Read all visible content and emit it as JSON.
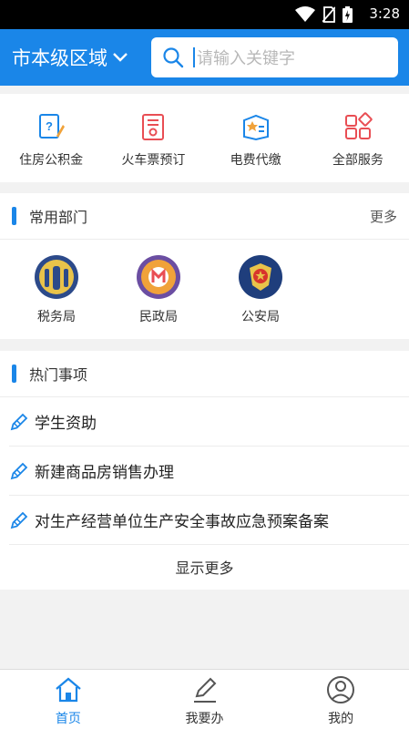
{
  "status_bar": {
    "time": "3:28"
  },
  "header": {
    "region": "市本级区域",
    "search_placeholder": "请输入关键字"
  },
  "services": [
    {
      "label": "住房公积金",
      "icon": "housing-fund-icon"
    },
    {
      "label": "火车票预订",
      "icon": "train-ticket-icon"
    },
    {
      "label": "电费代缴",
      "icon": "electricity-bill-icon"
    },
    {
      "label": "全部服务",
      "icon": "all-services-icon"
    }
  ],
  "departments": {
    "title": "常用部门",
    "more": "更多",
    "items": [
      {
        "label": "税务局",
        "icon": "tax-bureau-emblem-icon"
      },
      {
        "label": "民政局",
        "icon": "civil-affairs-emblem-icon"
      },
      {
        "label": "公安局",
        "icon": "police-emblem-icon"
      }
    ]
  },
  "hot_items": {
    "title": "热门事项",
    "items": [
      "学生资助",
      "新建商品房销售办理",
      "对生产经营单位生产安全事故应急预案备案"
    ],
    "show_more": "显示更多"
  },
  "tabs": [
    {
      "label": "首页",
      "active": true
    },
    {
      "label": "我要办",
      "active": false
    },
    {
      "label": "我的",
      "active": false
    }
  ],
  "colors": {
    "primary": "#1a86e8",
    "accent_red": "#e94e54",
    "accent_orange": "#f0a23a"
  }
}
